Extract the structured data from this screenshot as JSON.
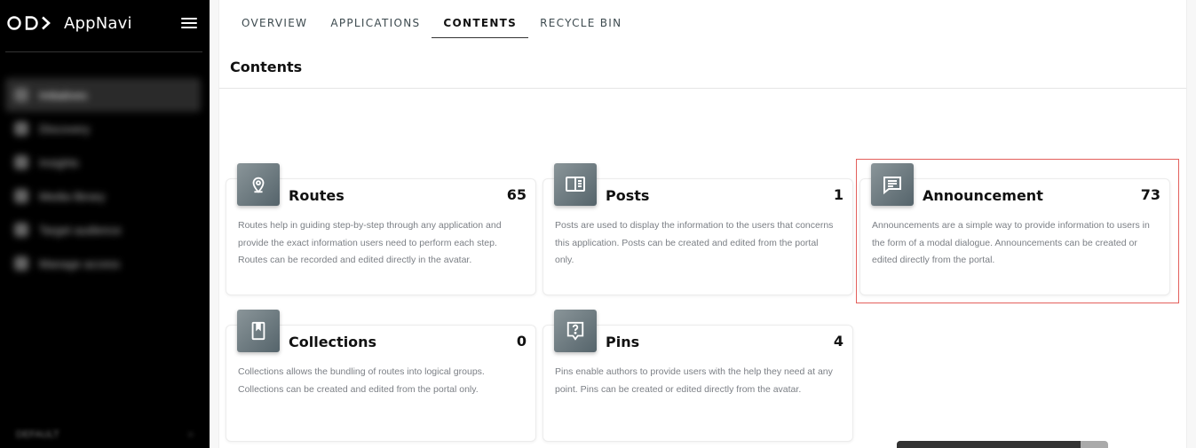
{
  "brand": {
    "name": "AppNavi"
  },
  "sidebar": {
    "items": [
      {
        "label": "Initiatives"
      },
      {
        "label": "Discovery"
      },
      {
        "label": "Insights"
      },
      {
        "label": "Media library"
      },
      {
        "label": "Target audience"
      },
      {
        "label": "Manage access"
      }
    ],
    "footer_left": "DEFAULT",
    "footer_right": "○"
  },
  "tabs": [
    {
      "label": "OVERVIEW"
    },
    {
      "label": "APPLICATIONS"
    },
    {
      "label": "CONTENTS"
    },
    {
      "label": "RECYCLE BIN"
    }
  ],
  "page": {
    "title": "Contents"
  },
  "cards": [
    {
      "title": "Routes",
      "count": "65",
      "icon": "map-pin-icon",
      "desc": "Routes help in guiding step-by-step through any application and provide the exact information users need to perform each step. Routes can be recorded and edited directly in the avatar."
    },
    {
      "title": "Posts",
      "count": "1",
      "icon": "book-open-icon",
      "desc": "Posts are used to display the information to the users that concerns this application. Posts can be created and edited from the portal only."
    },
    {
      "title": "Announcement",
      "count": "73",
      "icon": "message-icon",
      "desc": "Announcements are a simple way to provide information to users in the form of a modal dialogue. Announcements can be created or edited directly from the portal."
    },
    {
      "title": "Collections",
      "count": "0",
      "icon": "bookmark-icon",
      "desc": "Collections allows the bundling of routes into logical groups. Collections can be created and edited from the portal only."
    },
    {
      "title": "Pins",
      "count": "4",
      "icon": "help-pin-icon",
      "desc": "Pins enable authors to provide users with the help they need at any point. Pins can be created or edited directly from the avatar."
    }
  ],
  "colors": {
    "highlight": "#e3605c",
    "icon_tile": "#6b787e",
    "sidebar_bg": "#000000"
  }
}
